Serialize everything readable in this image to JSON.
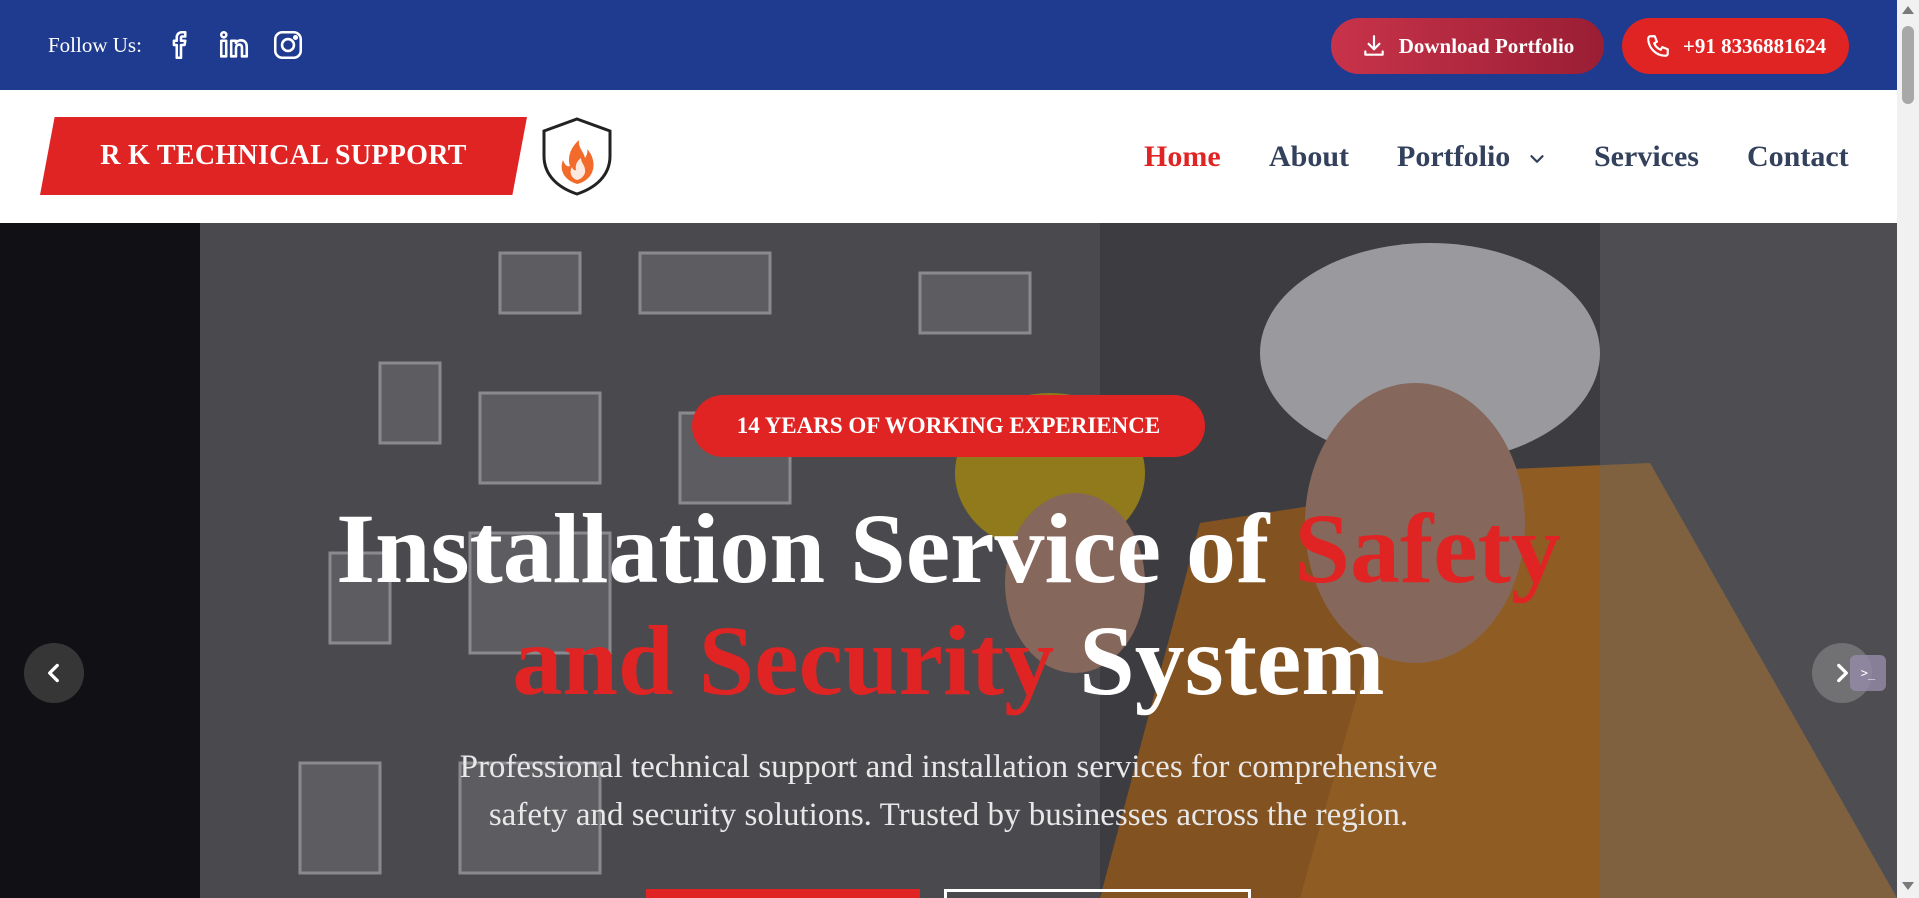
{
  "topbar": {
    "follow_label": "Follow Us:",
    "social_icons": [
      "facebook-icon",
      "linkedin-icon",
      "instagram-icon"
    ],
    "download_label": "Download Portfolio",
    "phone_label": "+91 8336881624"
  },
  "header": {
    "brand_name": "R K TECHNICAL SUPPORT",
    "nav": [
      {
        "label": "Home",
        "active": true
      },
      {
        "label": "About",
        "active": false
      },
      {
        "label": "Portfolio",
        "active": false,
        "has_dropdown": true
      },
      {
        "label": "Services",
        "active": false
      },
      {
        "label": "Contact",
        "active": false
      }
    ]
  },
  "hero": {
    "badge": "14 YEARS OF WORKING EXPERIENCE",
    "headline_part1": "Installation Service of ",
    "headline_accent1": "Safety",
    "headline_accent2": "and Security",
    "headline_part2": " System",
    "subtitle_line1": "Professional technical support and installation services for comprehensive",
    "subtitle_line2": "safety and security solutions. Trusted by businesses across the region."
  },
  "colors": {
    "topbar_bg": "#1f3b8f",
    "accent_red": "#e02424",
    "nav_text": "#33415c"
  }
}
